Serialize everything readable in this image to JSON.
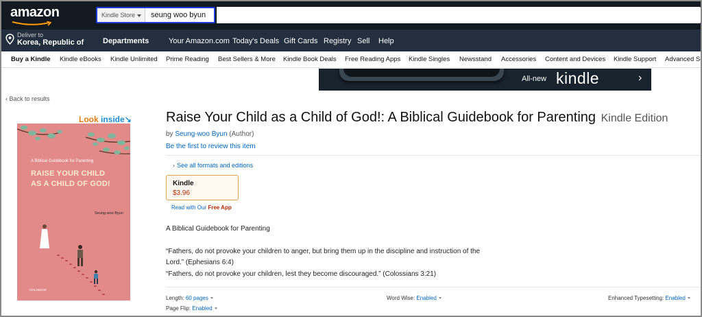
{
  "header": {
    "logo_text": "amazon",
    "search": {
      "category": "Kindle Store",
      "query": "seung woo byun"
    }
  },
  "nav": {
    "deliver_label": "Deliver to",
    "deliver_location": "Korea, Republic of",
    "departments": "Departments",
    "items": [
      "Your Amazon.com",
      "Today's Deals",
      "Gift Cards",
      "Registry",
      "Sell",
      "Help"
    ]
  },
  "subnav": {
    "items": [
      "Buy a Kindle",
      "Kindle eBooks",
      "Kindle Unlimited",
      "Prime Reading",
      "Best Sellers & More",
      "Kindle Book Deals",
      "Free Reading Apps",
      "Kindle Singles",
      "Newsstand",
      "Accessories",
      "Content and Devices",
      "Kindle Support",
      "Advanced Se"
    ]
  },
  "banner": {
    "all_new": "All-new",
    "brand": "kindle",
    "arrow": "›"
  },
  "back_link": "‹ Back to results",
  "look_inside": {
    "look": "Look ",
    "inside": "inside",
    "arrow": "↘"
  },
  "cover": {
    "subtitle": "A Biblical Guidebook for Parenting",
    "title_line1": "RAISE YOUR CHILD",
    "title_line2": "AS A CHILD OF GOD!",
    "author": "Seung-woo Byun",
    "publisher": "HOLYBOOK"
  },
  "product": {
    "title": "Raise Your Child as a Child of God!: A Biblical Guidebook for Parenting",
    "edition": "Kindle Edition",
    "by": "by ",
    "author": "Seung-woo Byun",
    "author_role": " (Author)",
    "review_link": "Be the first to review this item",
    "formats_link": "See all formats and editions",
    "format_name": "Kindle",
    "format_price": "$3.96",
    "free_app_prefix": "Read with Our ",
    "free_app_link": "Free App",
    "description": [
      "A Biblical Guidebook for Parenting",
      "“Fathers, do not provoke your children to anger, but bring them up in the discipline and instruction of the",
      "Lord.” (Ephesians 6:4)",
      "“Fathers, do not provoke your children, lest they become discouraged.” (Colossians 3:21)"
    ],
    "details": {
      "length_label": "Length: ",
      "length_value": "60 pages",
      "word_wise_label": "Word Wise: ",
      "word_wise_value": "Enabled",
      "typesetting_label": "Enhanced Typesetting: ",
      "typesetting_value": "Enabled",
      "page_flip_label": "Page Flip: ",
      "page_flip_value": "Enabled"
    }
  },
  "colors": {
    "nav_dark": "#131921",
    "nav_secondary": "#232f3e",
    "link": "#0066c0",
    "price": "#b12704",
    "accent_orange": "#e47911",
    "search_highlight": "#1d3bdb",
    "cover_pink": "#e28a8a"
  }
}
